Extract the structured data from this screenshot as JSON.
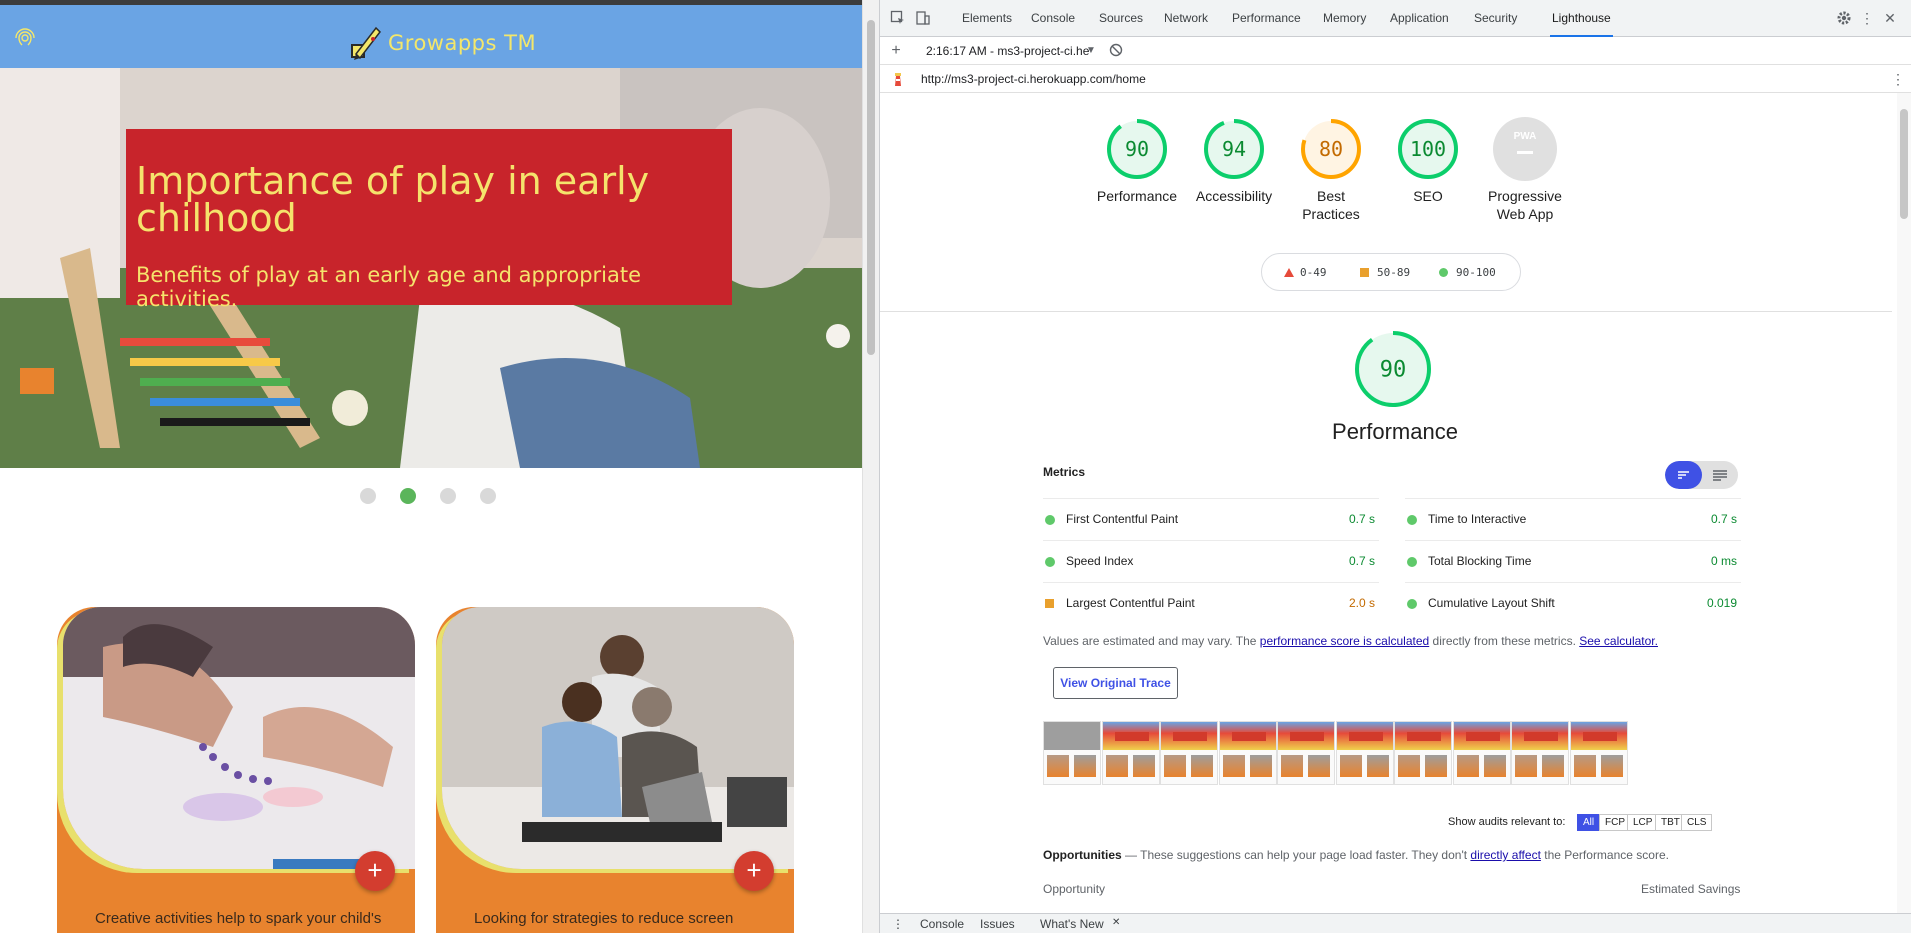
{
  "site": {
    "logo_text": "Growapps TM",
    "hero": {
      "title": "Importance of play in early chilhood",
      "subtitle": "Benefits of play at an early age and appropriate activities."
    },
    "carousel": {
      "slide_count": 4,
      "active_index": 1
    },
    "cards": [
      {
        "text": "Creative activities help to spark your child's",
        "add_label": "+"
      },
      {
        "text": "Looking for strategies to reduce screen",
        "add_label": "+"
      }
    ]
  },
  "devtools": {
    "tabs": [
      "Elements",
      "Console",
      "Sources",
      "Network",
      "Performance",
      "Memory",
      "Application",
      "Security",
      "Lighthouse"
    ],
    "active_tab": "Lighthouse",
    "report_selector": "2:16:17 AM - ms3-project-ci.he",
    "url": "http://ms3-project-ci.herokuapp.com/home",
    "drawer_tabs": [
      "Console",
      "Issues",
      "What's New"
    ],
    "drawer_close": "✕"
  },
  "lighthouse": {
    "categories": [
      {
        "label": "Performance",
        "score": "90",
        "status": "pass"
      },
      {
        "label": "Accessibility",
        "score": "94",
        "status": "pass"
      },
      {
        "label": "Best Practices",
        "score": "80",
        "status": "average"
      },
      {
        "label": "SEO",
        "score": "100",
        "status": "pass"
      },
      {
        "label": "Progressive Web App",
        "score": "PWA",
        "status": "na"
      }
    ],
    "legend": [
      {
        "range": "0-49",
        "status": "fail"
      },
      {
        "range": "50-89",
        "status": "average"
      },
      {
        "range": "90-100",
        "status": "pass"
      }
    ],
    "performance": {
      "score": "90",
      "title": "Performance",
      "metrics_heading": "Metrics",
      "metrics": [
        {
          "name": "First Contentful Paint",
          "value": "0.7 s",
          "status": "pass"
        },
        {
          "name": "Time to Interactive",
          "value": "0.7 s",
          "status": "pass"
        },
        {
          "name": "Speed Index",
          "value": "0.7 s",
          "status": "pass"
        },
        {
          "name": "Total Blocking Time",
          "value": "0 ms",
          "status": "pass"
        },
        {
          "name": "Largest Contentful Paint",
          "value": "2.0 s",
          "status": "average"
        },
        {
          "name": "Cumulative Layout Shift",
          "value": "0.019",
          "status": "pass"
        }
      ],
      "note_prefix": "Values are estimated and may vary. The ",
      "note_link": "performance score is calculated",
      "note_middle": " directly from these metrics. ",
      "note_link2": "See calculator.",
      "view_trace": "View Original Trace",
      "filmstrip_frames": 10
    },
    "audit_filter": {
      "label": "Show audits relevant to:",
      "options": [
        "All",
        "FCP",
        "LCP",
        "TBT",
        "CLS"
      ],
      "active": "All"
    },
    "opportunities": {
      "title": "Opportunities",
      "dash": " — ",
      "desc_prefix": "These suggestions can help your page load faster. They don't ",
      "desc_link": "directly affect",
      "desc_suffix": " the Performance score.",
      "col_opportunity": "Opportunity",
      "col_savings": "Estimated Savings"
    }
  },
  "colors": {
    "site_header": "#6aa4e4",
    "hero_caption_bg": "#c8242b",
    "hero_caption_text": "#f5e36c",
    "card_bg": "#e8832e",
    "pass": "#0cce6b",
    "average": "#ffa400",
    "fail": "#ff4e42",
    "lighthouse_accent": "#3f51e5"
  }
}
